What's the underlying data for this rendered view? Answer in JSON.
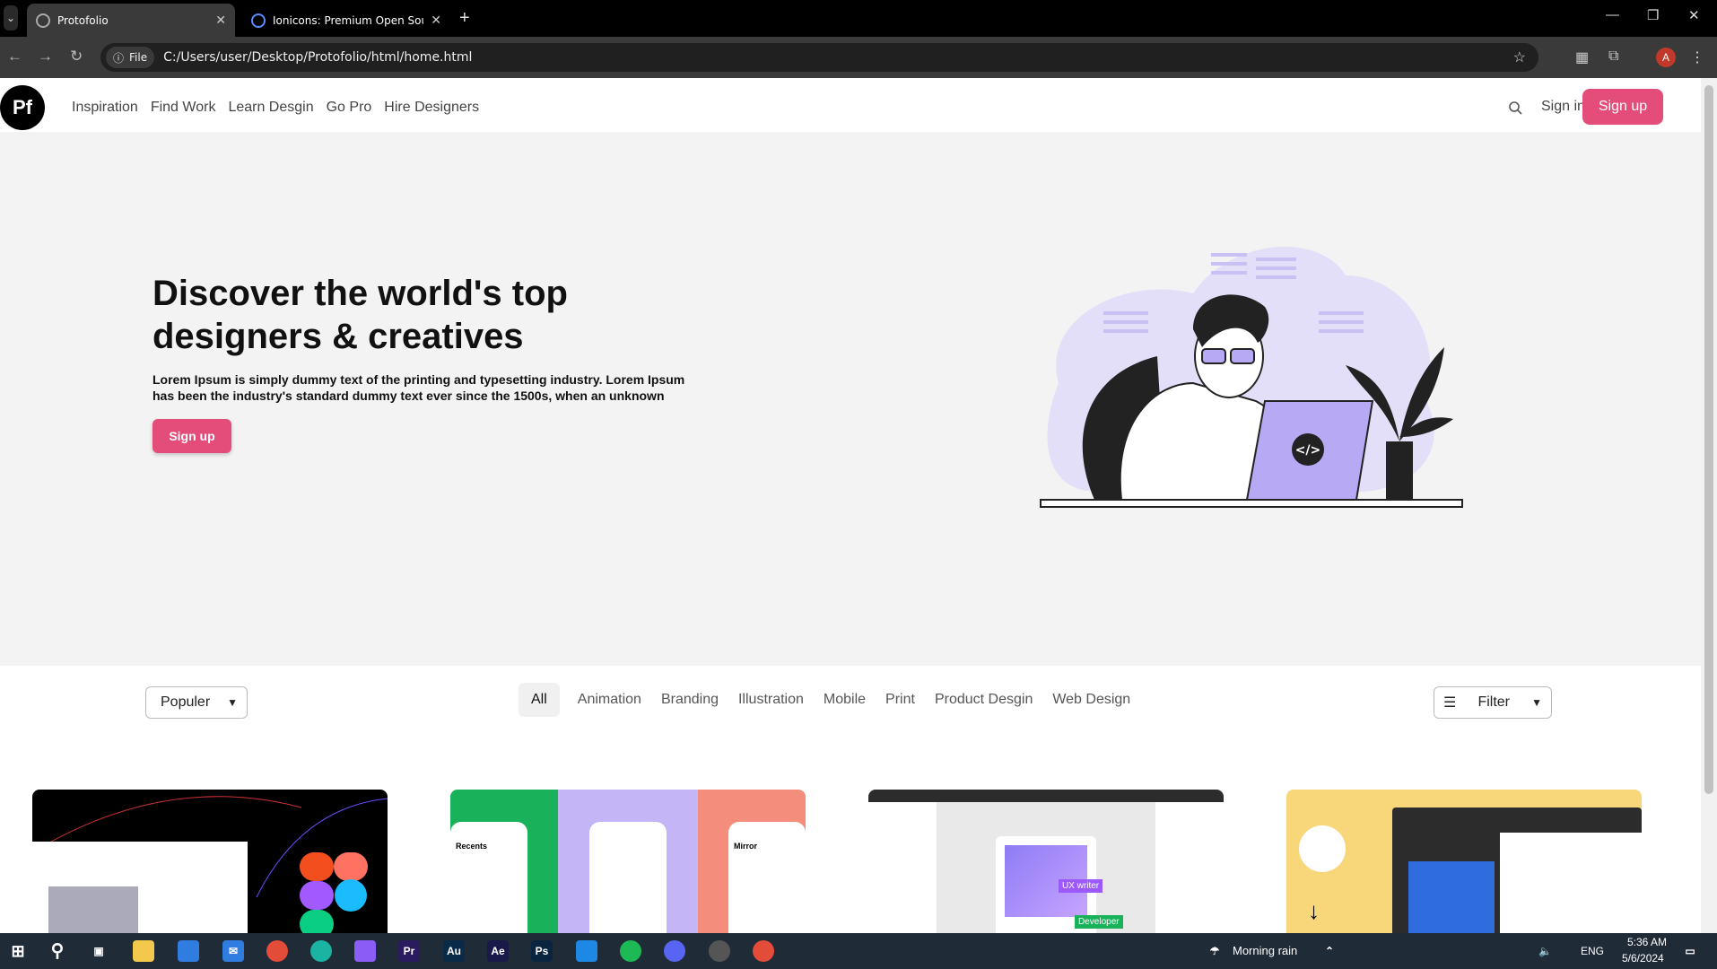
{
  "browser": {
    "tabs": [
      {
        "title": "Protofolio",
        "active": true
      },
      {
        "title": "Ionicons: Premium Open Source",
        "active": false
      }
    ],
    "file_label": "File",
    "url": "C:/Users/user/Desktop/Protofolio/html/home.html",
    "profile_initial": "A"
  },
  "site": {
    "logo": "Pf",
    "nav": [
      "Inspiration",
      "Find Work",
      "Learn Desgin",
      "Go Pro",
      "Hire Designers"
    ],
    "signin": "Sign in",
    "signup": "Sign up"
  },
  "hero": {
    "title": "Discover the world's top designers & creatives",
    "text": "Lorem Ipsum is simply dummy text of the printing and typesetting industry. Lorem Ipsum has been the industry's standard dummy text ever since the 1500s, when an unknown",
    "cta": "Sign up",
    "code_badge": "</>"
  },
  "filters": {
    "sort_selected": "Populer",
    "categories": [
      "All",
      "Animation",
      "Branding",
      "Illustration",
      "Mobile",
      "Print",
      "Product Desgin",
      "Web Design"
    ],
    "active_category": "All",
    "filter_label": "Filter"
  },
  "shots": {
    "shot2_label": "Recents",
    "shot2_label2": "Mirror",
    "shot3_tag1": "UX writer",
    "shot3_tag2": "Developer"
  },
  "taskbar": {
    "weather": "Morning rain",
    "lang": "ENG",
    "time": "5:36 AM",
    "date": "5/6/2024"
  },
  "colors": {
    "accent": "#e44d7a",
    "hero_bg": "#f4f3f3",
    "illus_purple": "#b8a9f5"
  }
}
